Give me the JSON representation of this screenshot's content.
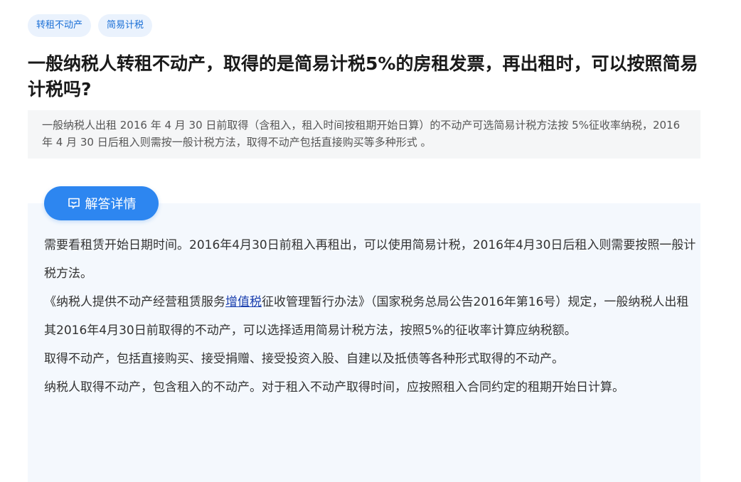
{
  "tags": [
    {
      "label": "转租不动产"
    },
    {
      "label": "简易计税"
    }
  ],
  "title": "一般纳税人转租不动产，取得的是简易计税5%的房租发票，再出租时，可以按照简易计税吗?",
  "summary": "一般纳税人出租 2016 年 4 月 30 日前取得（含租入，租入时间按租期开始日算）的不动产可选简易计税方法按 5%征收率纳税，2016 年 4 月 30 日后租入则需按一般计税方法，取得不动产包括直接购买等多种形式 。",
  "detail_button": {
    "label": "解答详情",
    "icon": "chat-bubble-icon"
  },
  "answer": {
    "p1": "需要看租赁开始日期时间。2016年4月30日前租入再租出，可以使用简易计税，2016年4月30日后租入则需要按照一般计税方法。",
    "p2_before": "《纳税人提供不动产经营租赁服务",
    "p2_link": "增值税",
    "p2_after": "征收管理暂行办法》（国家税务总局公告2016年第16号）规定，一般纳税人出租其2016年4月30日前取得的不动产，可以选择适用简易计税方法，按照5%的征收率计算应纳税额。",
    "p3": "取得不动产，包括直接购买、接受捐赠、接受投资入股、自建以及抵债等各种形式取得的不动产。",
    "p4": "纳税人取得不动产，包含租入的不动产。对于租入不动产取得时间，应按照租入合同约定的租期开始日计算。"
  },
  "colors": {
    "accent": "#2d86f0",
    "tag_bg": "#eaf2fd",
    "tag_text": "#1a6fd6",
    "panel_bg": "#f4f8fd",
    "summary_bg": "#f5f6f7",
    "link": "#1a3fae"
  }
}
